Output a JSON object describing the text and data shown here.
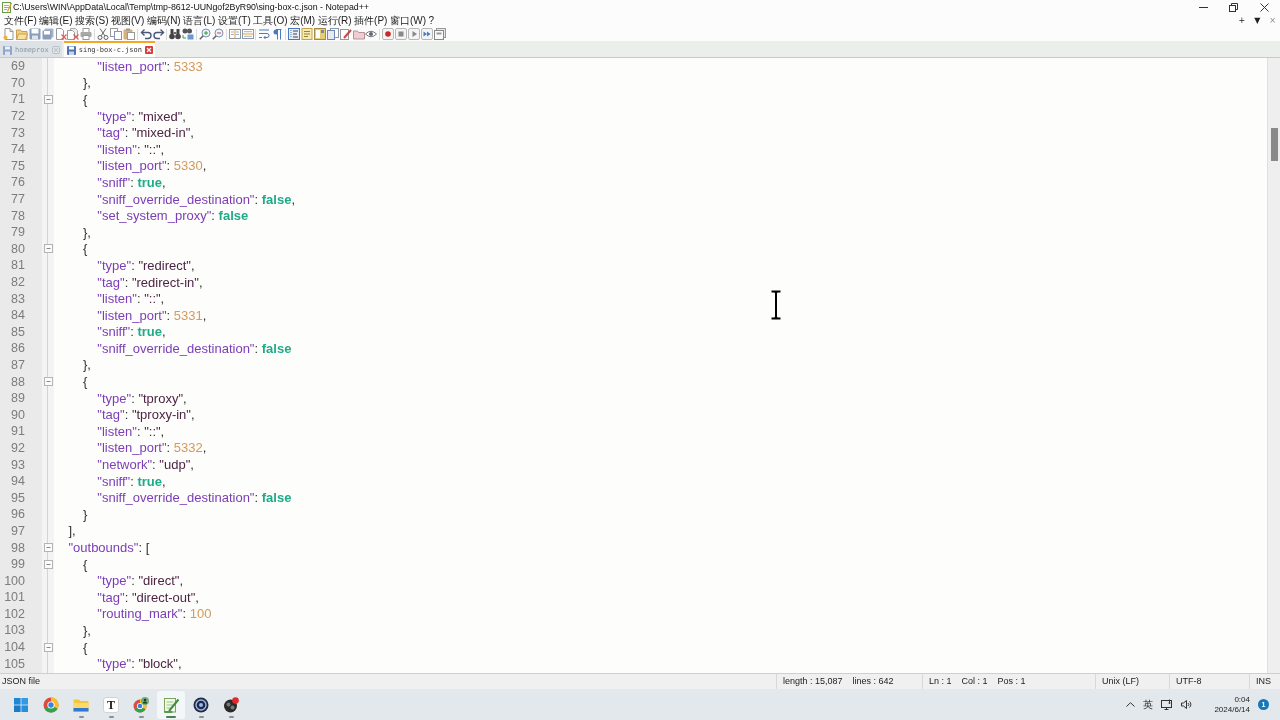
{
  "window": {
    "title": "C:\\Users\\WIN\\AppData\\Local\\Temp\\tmp-8612-UUNgof2ByR90\\sing-box-c.json - Notepad++"
  },
  "menu": [
    "文件(F)",
    "编辑(E)",
    "搜索(S)",
    "视图(V)",
    "编码(N)",
    "语言(L)",
    "设置(T)",
    "工具(O)",
    "宏(M)",
    "运行(R)",
    "插件(P)",
    "窗口(W)",
    "?"
  ],
  "menu_right": [
    {
      "kind": "add",
      "glyph": "+"
    },
    {
      "kind": "list",
      "glyph": "▼"
    },
    {
      "kind": "close",
      "glyph": "×"
    }
  ],
  "tabs": [
    {
      "label": "homeprox",
      "selected": false
    },
    {
      "label": "sing-box-c.json",
      "selected": true
    }
  ],
  "editor": {
    "lines": [
      {
        "number": "69",
        "foldable": false,
        "tokens": [
          {
            "kind": "key",
            "text": "            \"listen_port\""
          },
          {
            "kind": "punct",
            "text": ": "
          },
          {
            "kind": "number",
            "text": "5333"
          }
        ]
      },
      {
        "number": "70",
        "foldable": false,
        "tokens": [
          {
            "kind": "punct",
            "text": "        },"
          }
        ]
      },
      {
        "number": "71",
        "foldable": true,
        "tokens": [
          {
            "kind": "punct",
            "text": "        {"
          }
        ]
      },
      {
        "number": "72",
        "foldable": false,
        "tokens": [
          {
            "kind": "key",
            "text": "            \"type\""
          },
          {
            "kind": "punct",
            "text": ": "
          },
          {
            "kind": "string",
            "text": "\"mixed\""
          },
          {
            "kind": "punct",
            "text": ","
          }
        ]
      },
      {
        "number": "73",
        "foldable": false,
        "tokens": [
          {
            "kind": "key",
            "text": "            \"tag\""
          },
          {
            "kind": "punct",
            "text": ": "
          },
          {
            "kind": "string",
            "text": "\"mixed-in\""
          },
          {
            "kind": "punct",
            "text": ","
          }
        ]
      },
      {
        "number": "74",
        "foldable": false,
        "tokens": [
          {
            "kind": "key",
            "text": "            \"listen\""
          },
          {
            "kind": "punct",
            "text": ": "
          },
          {
            "kind": "string",
            "text": "\"::\""
          },
          {
            "kind": "punct",
            "text": ","
          }
        ]
      },
      {
        "number": "75",
        "foldable": false,
        "tokens": [
          {
            "kind": "key",
            "text": "            \"listen_port\""
          },
          {
            "kind": "punct",
            "text": ": "
          },
          {
            "kind": "number",
            "text": "5330"
          },
          {
            "kind": "punct",
            "text": ","
          }
        ]
      },
      {
        "number": "76",
        "foldable": false,
        "tokens": [
          {
            "kind": "key",
            "text": "            \"sniff\""
          },
          {
            "kind": "punct",
            "text": ": "
          },
          {
            "kind": "boolean",
            "text": "true"
          },
          {
            "kind": "punct",
            "text": ","
          }
        ]
      },
      {
        "number": "77",
        "foldable": false,
        "tokens": [
          {
            "kind": "key",
            "text": "            \"sniff_override_destination\""
          },
          {
            "kind": "punct",
            "text": ": "
          },
          {
            "kind": "boolean",
            "text": "false"
          },
          {
            "kind": "punct",
            "text": ","
          }
        ]
      },
      {
        "number": "78",
        "foldable": false,
        "tokens": [
          {
            "kind": "key",
            "text": "            \"set_system_proxy\""
          },
          {
            "kind": "punct",
            "text": ": "
          },
          {
            "kind": "boolean",
            "text": "false"
          }
        ]
      },
      {
        "number": "79",
        "foldable": false,
        "tokens": [
          {
            "kind": "punct",
            "text": "        },"
          }
        ]
      },
      {
        "number": "80",
        "foldable": true,
        "tokens": [
          {
            "kind": "punct",
            "text": "        {"
          }
        ]
      },
      {
        "number": "81",
        "foldable": false,
        "tokens": [
          {
            "kind": "key",
            "text": "            \"type\""
          },
          {
            "kind": "punct",
            "text": ": "
          },
          {
            "kind": "string",
            "text": "\"redirect\""
          },
          {
            "kind": "punct",
            "text": ","
          }
        ]
      },
      {
        "number": "82",
        "foldable": false,
        "tokens": [
          {
            "kind": "key",
            "text": "            \"tag\""
          },
          {
            "kind": "punct",
            "text": ": "
          },
          {
            "kind": "string",
            "text": "\"redirect-in\""
          },
          {
            "kind": "punct",
            "text": ","
          }
        ]
      },
      {
        "number": "83",
        "foldable": false,
        "tokens": [
          {
            "kind": "key",
            "text": "            \"listen\""
          },
          {
            "kind": "punct",
            "text": ": "
          },
          {
            "kind": "string",
            "text": "\"::\""
          },
          {
            "kind": "punct",
            "text": ","
          }
        ]
      },
      {
        "number": "84",
        "foldable": false,
        "tokens": [
          {
            "kind": "key",
            "text": "            \"listen_port\""
          },
          {
            "kind": "punct",
            "text": ": "
          },
          {
            "kind": "number",
            "text": "5331"
          },
          {
            "kind": "punct",
            "text": ","
          }
        ]
      },
      {
        "number": "85",
        "foldable": false,
        "tokens": [
          {
            "kind": "key",
            "text": "            \"sniff\""
          },
          {
            "kind": "punct",
            "text": ": "
          },
          {
            "kind": "boolean",
            "text": "true"
          },
          {
            "kind": "punct",
            "text": ","
          }
        ]
      },
      {
        "number": "86",
        "foldable": false,
        "tokens": [
          {
            "kind": "key",
            "text": "            \"sniff_override_destination\""
          },
          {
            "kind": "punct",
            "text": ": "
          },
          {
            "kind": "boolean",
            "text": "false"
          }
        ]
      },
      {
        "number": "87",
        "foldable": false,
        "tokens": [
          {
            "kind": "punct",
            "text": "        },"
          }
        ]
      },
      {
        "number": "88",
        "foldable": true,
        "tokens": [
          {
            "kind": "punct",
            "text": "        {"
          }
        ]
      },
      {
        "number": "89",
        "foldable": false,
        "tokens": [
          {
            "kind": "key",
            "text": "            \"type\""
          },
          {
            "kind": "punct",
            "text": ": "
          },
          {
            "kind": "string",
            "text": "\"tproxy\""
          },
          {
            "kind": "punct",
            "text": ","
          }
        ]
      },
      {
        "number": "90",
        "foldable": false,
        "tokens": [
          {
            "kind": "key",
            "text": "            \"tag\""
          },
          {
            "kind": "punct",
            "text": ": "
          },
          {
            "kind": "string",
            "text": "\"tproxy-in\""
          },
          {
            "kind": "punct",
            "text": ","
          }
        ]
      },
      {
        "number": "91",
        "foldable": false,
        "tokens": [
          {
            "kind": "key",
            "text": "            \"listen\""
          },
          {
            "kind": "punct",
            "text": ": "
          },
          {
            "kind": "string",
            "text": "\"::\""
          },
          {
            "kind": "punct",
            "text": ","
          }
        ]
      },
      {
        "number": "92",
        "foldable": false,
        "tokens": [
          {
            "kind": "key",
            "text": "            \"listen_port\""
          },
          {
            "kind": "punct",
            "text": ": "
          },
          {
            "kind": "number",
            "text": "5332"
          },
          {
            "kind": "punct",
            "text": ","
          }
        ]
      },
      {
        "number": "93",
        "foldable": false,
        "tokens": [
          {
            "kind": "key",
            "text": "            \"network\""
          },
          {
            "kind": "punct",
            "text": ": "
          },
          {
            "kind": "string",
            "text": "\"udp\""
          },
          {
            "kind": "punct",
            "text": ","
          }
        ]
      },
      {
        "number": "94",
        "foldable": false,
        "tokens": [
          {
            "kind": "key",
            "text": "            \"sniff\""
          },
          {
            "kind": "punct",
            "text": ": "
          },
          {
            "kind": "boolean",
            "text": "true"
          },
          {
            "kind": "punct",
            "text": ","
          }
        ]
      },
      {
        "number": "95",
        "foldable": false,
        "tokens": [
          {
            "kind": "key",
            "text": "            \"sniff_override_destination\""
          },
          {
            "kind": "punct",
            "text": ": "
          },
          {
            "kind": "boolean",
            "text": "false"
          }
        ]
      },
      {
        "number": "96",
        "foldable": false,
        "tokens": [
          {
            "kind": "punct",
            "text": "        }"
          }
        ]
      },
      {
        "number": "97",
        "foldable": false,
        "tokens": [
          {
            "kind": "punct",
            "text": "    ],"
          }
        ]
      },
      {
        "number": "98",
        "foldable": true,
        "tokens": [
          {
            "kind": "key",
            "text": "    \"outbounds\""
          },
          {
            "kind": "punct",
            "text": ": ["
          }
        ]
      },
      {
        "number": "99",
        "foldable": true,
        "tokens": [
          {
            "kind": "punct",
            "text": "        {"
          }
        ]
      },
      {
        "number": "100",
        "foldable": false,
        "tokens": [
          {
            "kind": "key",
            "text": "            \"type\""
          },
          {
            "kind": "punct",
            "text": ": "
          },
          {
            "kind": "string",
            "text": "\"direct\""
          },
          {
            "kind": "punct",
            "text": ","
          }
        ]
      },
      {
        "number": "101",
        "foldable": false,
        "tokens": [
          {
            "kind": "key",
            "text": "            \"tag\""
          },
          {
            "kind": "punct",
            "text": ": "
          },
          {
            "kind": "string",
            "text": "\"direct-out\""
          },
          {
            "kind": "punct",
            "text": ","
          }
        ]
      },
      {
        "number": "102",
        "foldable": false,
        "tokens": [
          {
            "kind": "key",
            "text": "            \"routing_mark\""
          },
          {
            "kind": "punct",
            "text": ": "
          },
          {
            "kind": "number",
            "text": "100"
          }
        ]
      },
      {
        "number": "103",
        "foldable": false,
        "tokens": [
          {
            "kind": "punct",
            "text": "        },"
          }
        ]
      },
      {
        "number": "104",
        "foldable": true,
        "tokens": [
          {
            "kind": "punct",
            "text": "        {"
          }
        ]
      },
      {
        "number": "105",
        "foldable": false,
        "tokens": [
          {
            "kind": "key",
            "text": "            \"type\""
          },
          {
            "kind": "punct",
            "text": ": "
          },
          {
            "kind": "string",
            "text": "\"block\""
          },
          {
            "kind": "punct",
            "text": ","
          }
        ]
      }
    ]
  },
  "status_bar": {
    "file_type": "JSON file",
    "length": "length : 15,087",
    "lines": "lines : 642",
    "ln": "Ln : 1",
    "col": "Col : 1",
    "pos": "Pos : 1",
    "eol": "Unix (LF)",
    "encoding": "UTF-8",
    "mode": "INS"
  },
  "taskbar": {
    "apps": [
      {
        "kind": "start",
        "active": false,
        "running": false
      },
      {
        "kind": "browser",
        "active": false,
        "running": false
      },
      {
        "kind": "folder",
        "active": false,
        "running": true
      },
      {
        "kind": "letter",
        "label": "T",
        "active": false,
        "running": true
      },
      {
        "kind": "browser_profile",
        "active": false,
        "running": true
      },
      {
        "kind": "notepad",
        "active": true,
        "running": true
      },
      {
        "kind": "disc",
        "active": false,
        "running": true
      },
      {
        "kind": "round",
        "active": false,
        "running": true
      }
    ],
    "tray": {
      "ime": "英",
      "time": "0:04",
      "date": "2024/6/14",
      "notifications": "1"
    }
  }
}
